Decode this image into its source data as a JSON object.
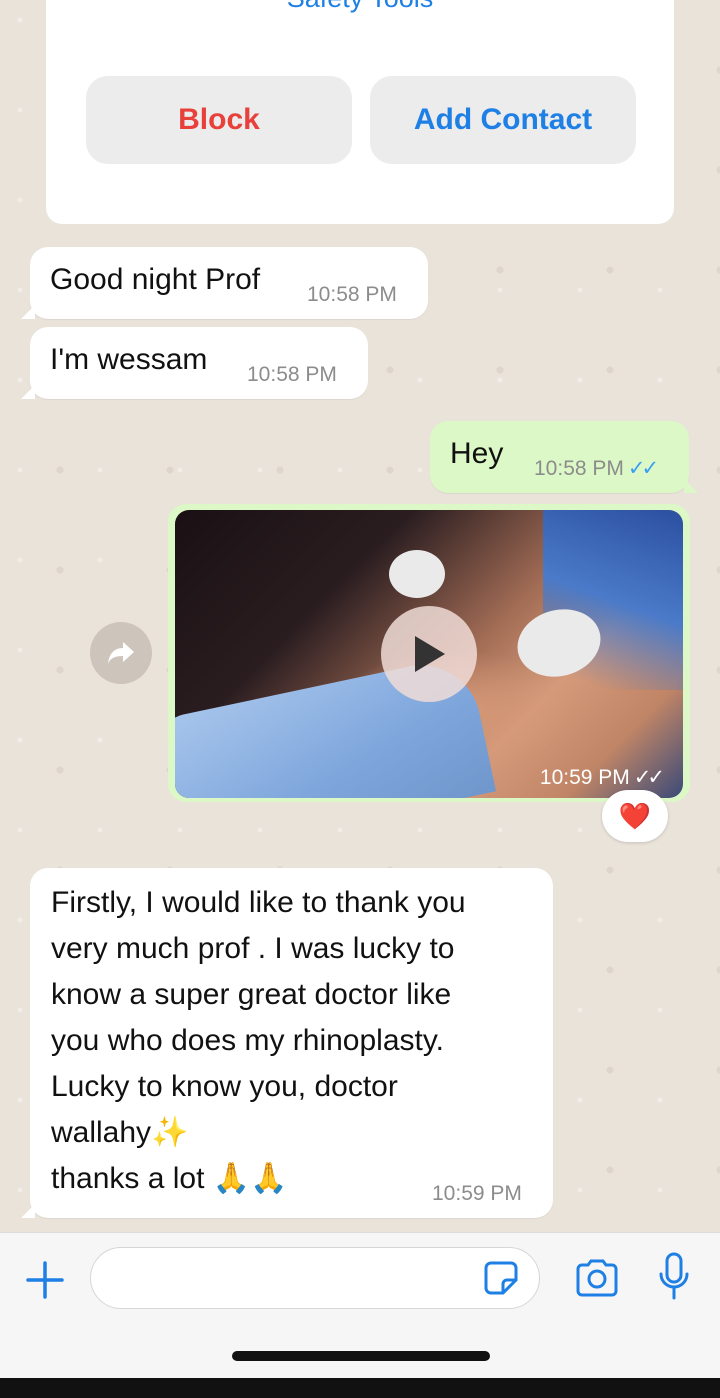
{
  "safety_card": {
    "link_label": "Safety Tools",
    "block_label": "Block",
    "add_contact_label": "Add Contact"
  },
  "messages": [
    {
      "direction": "incoming",
      "text": "Good night Prof",
      "time": "10:58 PM"
    },
    {
      "direction": "incoming",
      "text": "I'm wessam",
      "time": "10:58 PM"
    },
    {
      "direction": "outgoing",
      "text": "Hey",
      "time": "10:58 PM",
      "status_icon": "double-check-icon"
    },
    {
      "direction": "outgoing",
      "type": "video",
      "time": "10:59 PM",
      "status_icon": "double-check-icon",
      "reaction": "❤️"
    },
    {
      "direction": "incoming",
      "lines": [
        "Firstly, I would like to thank you",
        "very much prof . I was lucky to",
        "know a super great doctor like",
        "you who does my rhinoplasty.",
        "Lucky to know you, doctor",
        "wallahy",
        "thanks a lot"
      ],
      "emojis": {
        "sparkle": "✨",
        "pray": "🙏🙏"
      },
      "time": "10:59 PM"
    }
  ],
  "input_bar": {
    "placeholder": "",
    "icons": [
      "plus-icon",
      "sticker-icon",
      "camera-icon",
      "microphone-icon"
    ]
  },
  "colors": {
    "accent": "#1e7fe5",
    "danger": "#e8413c",
    "outgoing_bubble": "#dcf8c6",
    "read_ticks": "#39a0f4"
  }
}
